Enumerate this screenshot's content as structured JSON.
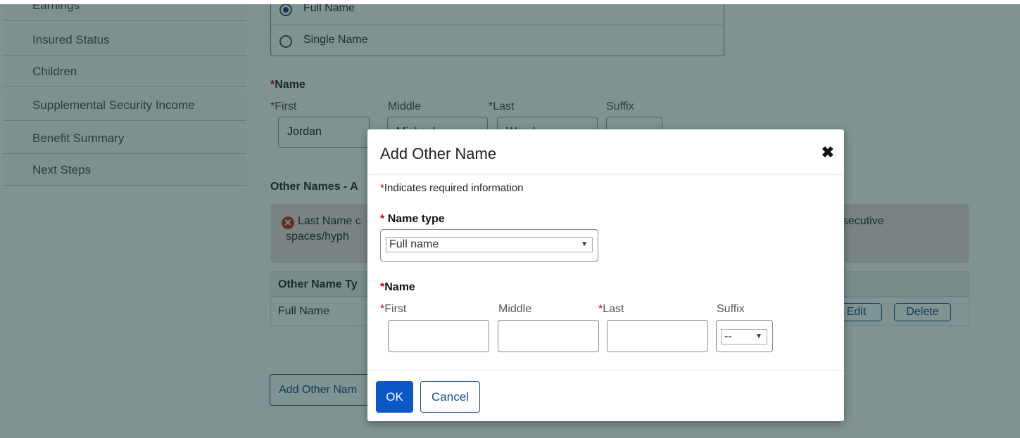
{
  "sidebar": {
    "items": [
      {
        "label": "Earnings"
      },
      {
        "label": "Insured Status"
      },
      {
        "label": "Children"
      },
      {
        "label": "Supplemental Security Income"
      },
      {
        "label": "Benefit Summary"
      },
      {
        "label": "Next Steps"
      }
    ]
  },
  "background": {
    "radio_full_name": "Full Name",
    "radio_single_name": "Single Name",
    "name_label": "Name",
    "first_label": "First",
    "middle_label": "Middle",
    "last_label": "Last",
    "suffix_label": "Suffix",
    "first_value": "Jordan",
    "middle_value": "Michael",
    "last_value": "Wood",
    "other_names_heading": "Other Names - A",
    "alert_line1_left": "Last Name c",
    "alert_line1_right": "nsecutive",
    "alert_line2": "spaces/hyph",
    "table_header": "Other Name Ty",
    "table_row_type": "Full Name",
    "edit_button": "Edit",
    "delete_button": "Delete",
    "add_other_name_button": "Add Other Nam"
  },
  "modal": {
    "title": "Add Other Name",
    "close_symbol": "✖",
    "required_note": "Indicates required information",
    "required_mark": "*",
    "name_type_label": "Name type",
    "name_type_value": "Full name",
    "name_label": "Name",
    "first_label": "First",
    "middle_label": "Middle",
    "last_label": "Last",
    "suffix_label": "Suffix",
    "suffix_value": "--",
    "ok_button": "OK",
    "cancel_button": "Cancel"
  },
  "colors": {
    "accent": "#0a58c8",
    "required": "#cc0000",
    "overlay": "#2a4b4b"
  }
}
